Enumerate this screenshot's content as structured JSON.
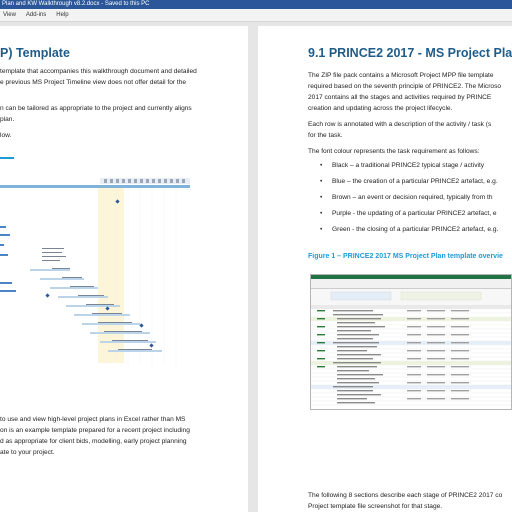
{
  "window": {
    "title": "Plan and KW Walkthrough v8.2.docx  -  Saved to this PC"
  },
  "ribbon": {
    "tabs": [
      "View",
      "Add-ins",
      "Help"
    ]
  },
  "left_page": {
    "heading": "P) Template",
    "para1": [
      "template that accompanies this walkthrough document and detailed",
      "e previous MS Project Timeline view does not offer detail for the"
    ],
    "para2": [
      "n can be tailored as appropriate to the project and currently aligns",
      "plan."
    ],
    "para3": "low.",
    "para4": [
      "to use and view high-level project plans in Excel rather than MS",
      "on is an example template prepared for a recent project including",
      "d as appropriate for client bids, modelling, early project planning",
      "ate to your project."
    ]
  },
  "right_page": {
    "heading": "9.1    PRINCE2 2017 - MS Project Plan Templ",
    "para1": [
      "The ZIP file pack contains a Microsoft Project MPP file template",
      "required based on the seventh principle of PRINCE2. The Microso",
      "2017 contains all the stages and activities required by PRINCE",
      "creation and updating across the project lifecycle."
    ],
    "para2": [
      "Each row is annotated with a description of the activity / task (s",
      "for the task."
    ],
    "para3": "The font colour represents the task requirement as follows:",
    "bullets": [
      "Black – a traditional PRINCE2 typical stage / activity",
      "Blue – the creation of a particular PRINCE2 artefact, e.g.",
      "Brown – an event or decision required, typically from th",
      "Purple - the updating of a particular PRINCE2 artefact, e",
      "Green - the closing of a particular PRINCE2 artefact, e.g."
    ],
    "figure_caption": "Figure 1 – PRINCE2 2017 MS Project Plan template overvie",
    "para4": [
      "The following 8 sections describe each stage of PRINCE2 2017 co",
      "Project template file screenshot for that stage."
    ]
  },
  "colors": {
    "titlebar": "#2b579a",
    "heading": "#1f5c8a",
    "caption": "#1e9bd7"
  }
}
